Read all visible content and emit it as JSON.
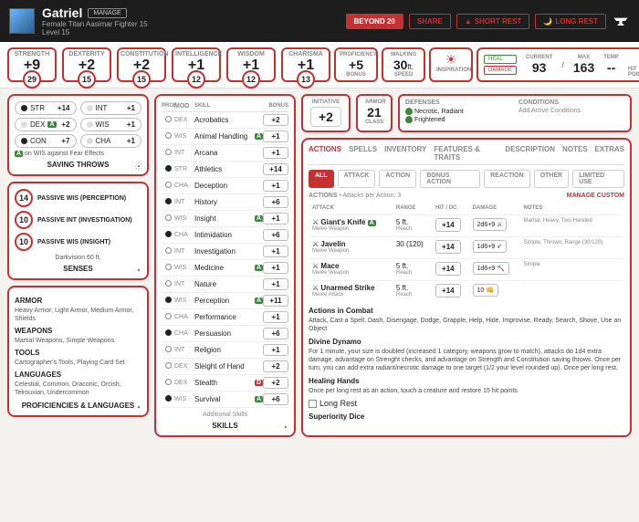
{
  "header": {
    "name": "Gatriel",
    "manage": "MANAGE",
    "subtitle": "Female  Titan Aasimar  Fighter 15",
    "level": "Level 15",
    "buttons": {
      "b20": "BEYOND 20",
      "share": "SHARE",
      "short": "SHORT REST",
      "long": "LONG REST"
    }
  },
  "abilities": [
    {
      "label": "STRENGTH",
      "mod": "+9",
      "score": "29"
    },
    {
      "label": "DEXTERITY",
      "mod": "+2",
      "score": "15"
    },
    {
      "label": "CONSTITUTION",
      "mod": "+2",
      "score": "15"
    },
    {
      "label": "INTELLIGENCE",
      "mod": "+1",
      "score": "12"
    },
    {
      "label": "WISDOM",
      "mod": "+1",
      "score": "12"
    },
    {
      "label": "CHARISMA",
      "mod": "+1",
      "score": "13"
    }
  ],
  "proficiency": {
    "label": "PROFICIENCY",
    "val": "+5",
    "sub": "BONUS"
  },
  "speed": {
    "label": "WALKING",
    "val": "30",
    "unit": "ft.",
    "sub": "SPEED"
  },
  "inspiration": "INSPIRATION",
  "hp": {
    "heal": "HEAL",
    "damage": "DAMAGE",
    "current_lbl": "CURRENT",
    "current": "93",
    "max_lbl": "MAX",
    "max": "163",
    "temp_lbl": "TEMP",
    "temp": "--",
    "title": "HIT POINTS"
  },
  "saves": {
    "rows": [
      [
        {
          "abbr": "STR",
          "val": "+14",
          "filled": true
        },
        {
          "abbr": "INT",
          "val": "+1",
          "filled": false
        }
      ],
      [
        {
          "abbr": "DEX",
          "val": "+2",
          "filled": false,
          "badge": "A"
        },
        {
          "abbr": "WIS",
          "val": "+1",
          "filled": false
        }
      ],
      [
        {
          "abbr": "CON",
          "val": "+7",
          "filled": true
        },
        {
          "abbr": "CHA",
          "val": "+1",
          "filled": false
        }
      ]
    ],
    "note": "on WIS against Fear Effects",
    "title": "SAVING THROWS"
  },
  "passives": {
    "items": [
      {
        "val": "14",
        "lbl": "PASSIVE WIS (PERCEPTION)"
      },
      {
        "val": "10",
        "lbl": "PASSIVE INT (INVESTIGATION)"
      },
      {
        "val": "10",
        "lbl": "PASSIVE WIS (INSIGHT)"
      }
    ],
    "extra": "Darkvision 60 ft.",
    "title": "SENSES"
  },
  "profs": {
    "armor_h": "ARMOR",
    "armor": "Heavy Armor, Light Armor, Medium Armor, Shields",
    "weapons_h": "WEAPONS",
    "weapons": "Martial Weapons, Simple Weapons",
    "tools_h": "TOOLS",
    "tools": "Cartographer's Tools, Playing Card Set",
    "lang_h": "LANGUAGES",
    "lang": "Celestial, Common, Draconic, Orcish, Telrouxian, Undercommon",
    "title": "PROFICIENCIES & LANGUAGES"
  },
  "skills": {
    "hdr": {
      "prof": "PROF",
      "mod": "MOD",
      "skill": "SKILL",
      "bonus": "BONUS"
    },
    "list": [
      {
        "p": 0,
        "mod": "DEX",
        "name": "Acrobatics",
        "bonus": "+2"
      },
      {
        "p": 0,
        "mod": "WIS",
        "name": "Animal Handling",
        "bonus": "+1",
        "badge": "A"
      },
      {
        "p": 0,
        "mod": "INT",
        "name": "Arcana",
        "bonus": "+1"
      },
      {
        "p": 1,
        "mod": "STR",
        "name": "Athletics",
        "bonus": "+14"
      },
      {
        "p": 0,
        "mod": "CHA",
        "name": "Deception",
        "bonus": "+1"
      },
      {
        "p": 1,
        "mod": "INT",
        "name": "History",
        "bonus": "+6"
      },
      {
        "p": 0,
        "mod": "WIS",
        "name": "Insight",
        "bonus": "+1",
        "badge": "A"
      },
      {
        "p": 1,
        "mod": "CHA",
        "name": "Intimidation",
        "bonus": "+6"
      },
      {
        "p": 0,
        "mod": "INT",
        "name": "Investigation",
        "bonus": "+1"
      },
      {
        "p": 0,
        "mod": "WIS",
        "name": "Medicine",
        "bonus": "+1",
        "badge": "A"
      },
      {
        "p": 0,
        "mod": "INT",
        "name": "Nature",
        "bonus": "+1"
      },
      {
        "p": 1,
        "mod": "WIS",
        "name": "Perception",
        "bonus": "+11",
        "badge": "A"
      },
      {
        "p": 0,
        "mod": "CHA",
        "name": "Performance",
        "bonus": "+1"
      },
      {
        "p": 1,
        "mod": "CHA",
        "name": "Persuasion",
        "bonus": "+6"
      },
      {
        "p": 0,
        "mod": "INT",
        "name": "Religion",
        "bonus": "+1"
      },
      {
        "p": 0,
        "mod": "DEX",
        "name": "Sleight of Hand",
        "bonus": "+2"
      },
      {
        "p": 0,
        "mod": "DEX",
        "name": "Stealth",
        "bonus": "+2",
        "dis": "D"
      },
      {
        "p": 1,
        "mod": "WIS",
        "name": "Survival",
        "bonus": "+6",
        "badge": "A"
      }
    ],
    "addl": "Additional Skills",
    "title": "SKILLS"
  },
  "initiative": {
    "lbl": "INITIATIVE",
    "val": "+2"
  },
  "ac": {
    "lbl": "ARMOR",
    "val": "21",
    "sub": "CLASS"
  },
  "defenses": {
    "hdr": "DEFENSES",
    "items": [
      "Necrotic, Radiant",
      "Frightened"
    ]
  },
  "conditions": {
    "hdr": "CONDITIONS",
    "add": "Add Active Conditions"
  },
  "mainTabs": [
    "ACTIONS",
    "SPELLS",
    "INVENTORY",
    "FEATURES & TRAITS",
    "DESCRIPTION",
    "NOTES",
    "EXTRAS"
  ],
  "subTabs": [
    "ALL",
    "ATTACK",
    "ACTION",
    "BONUS ACTION",
    "REACTION",
    "OTHER",
    "LIMITED USE"
  ],
  "actions": {
    "hdr": "ACTIONS",
    "per": "Attacks per Action: 3",
    "manage": "MANAGE CUSTOM",
    "cols": {
      "atk": "ATTACK",
      "range": "RANGE",
      "hit": "HIT / DC",
      "dmg": "DAMAGE",
      "notes": "NOTES"
    },
    "rows": [
      {
        "name": "Giant's Knife",
        "sub": "Melee Weapon",
        "range": "5 ft.",
        "rsub": "Reach",
        "hit": "+14",
        "dmg": "2d6+9",
        "dico": "⚔",
        "notes": "Martial, Heavy, Two-Handed",
        "badge": "A"
      },
      {
        "name": "Javelin",
        "sub": "Melee Weapon",
        "range": "30 (120)",
        "rsub": "",
        "hit": "+14",
        "dmg": "1d6+9",
        "dico": "➶",
        "notes": "Simple, Thrown, Range (30/120)"
      },
      {
        "name": "Mace",
        "sub": "Melee Weapon",
        "range": "5 ft.",
        "rsub": "Reach",
        "hit": "+14",
        "dmg": "1d6+9",
        "dico": "🔨",
        "notes": "Simple"
      },
      {
        "name": "Unarmed Strike",
        "sub": "Melee Attack",
        "range": "5 ft.",
        "rsub": "Reach",
        "hit": "+14",
        "dmg": "10",
        "dico": "👊",
        "notes": ""
      }
    ],
    "combat_h": "Actions in Combat",
    "combat": "Attack, Cast a Spell, Dash, Disengage, Dodge, Grapple, Help, Hide, Improvise, Ready, Search, Shove, Use an Object",
    "dynamo_h": "Divine Dynamo",
    "dynamo": "For 1 minute, your size is doubled (increased 1 category, weapons grow to match), attacks do 1d4 extra damage, advantage on Strenght checks, and advantage on Strength and Constitution saving throws. Once per turn, you can add extra radiant/necrotic damage to one target (1/2 your level rounded up). Once per long rest.",
    "heal_h": "Healing Hands",
    "heal": "Once per long rest as an action, touch a creature and restore 15 hit points.",
    "longrest": "Long Rest",
    "sup_h": "Superiority Dice"
  }
}
